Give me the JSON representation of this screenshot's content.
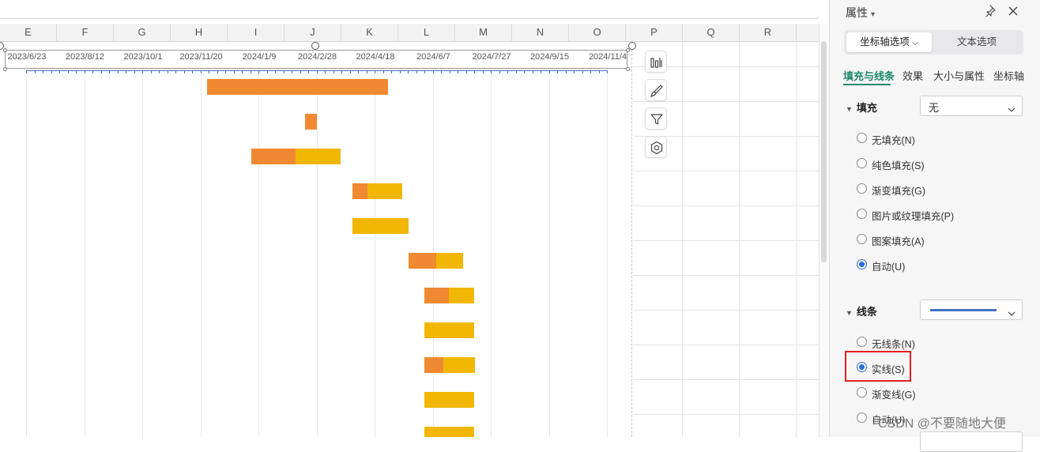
{
  "sheet": {
    "columns": [
      "E",
      "F",
      "G",
      "H",
      "I",
      "J",
      "K",
      "L",
      "M",
      "N",
      "O",
      "P",
      "Q",
      "R"
    ]
  },
  "chart": {
    "axis_tick_labels": [
      "2023/6/23",
      "2023/8/12",
      "2023/10/1",
      "2023/11/20",
      "2024/1/9",
      "2024/2/28",
      "2024/4/18",
      "2024/6/7",
      "2024/7/27",
      "2024/9/15",
      "2024/11/4"
    ],
    "colors": {
      "primary": "#f08a32",
      "secondary": "#f2b705",
      "axis": "#4472c4"
    },
    "side_buttons": [
      "chart-elements-icon",
      "chart-style-icon",
      "chart-filter-icon",
      "chart-settings-icon"
    ]
  },
  "chart_data": {
    "type": "bar",
    "orientation": "horizontal",
    "stacked": true,
    "x_axis_position": "top",
    "x_tick_labels": [
      "2023/6/23",
      "2023/8/12",
      "2023/10/1",
      "2023/11/20",
      "2024/1/9",
      "2024/2/28",
      "2024/4/18",
      "2024/6/7",
      "2024/7/27",
      "2024/9/15",
      "2024/11/4"
    ],
    "xlim": [
      "2023/6/23",
      "2024/11/4"
    ],
    "grid": "vertical",
    "legend": "none",
    "rows": [
      {
        "start": "2023/11/26",
        "segments": [
          {
            "color": "#f08a32",
            "days": 156
          }
        ]
      },
      {
        "start": "2024/2/18",
        "segments": [
          {
            "color": "#f08a32",
            "days": 10
          }
        ]
      },
      {
        "start": "2024/1/3",
        "segments": [
          {
            "color": "#f08a32",
            "days": 38
          },
          {
            "color": "#f2b705",
            "days": 39
          }
        ]
      },
      {
        "start": "2024/3/30",
        "segments": [
          {
            "color": "#f08a32",
            "days": 13
          },
          {
            "color": "#f2b705",
            "days": 30
          }
        ]
      },
      {
        "start": "2024/3/30",
        "segments": [
          {
            "color": "#f2b705",
            "days": 48
          }
        ]
      },
      {
        "start": "2024/5/17",
        "segments": [
          {
            "color": "#f08a32",
            "days": 24
          },
          {
            "color": "#f2b705",
            "days": 23
          }
        ]
      },
      {
        "start": "2024/5/31",
        "segments": [
          {
            "color": "#f08a32",
            "days": 21
          },
          {
            "color": "#f2b705",
            "days": 22
          }
        ]
      },
      {
        "start": "2024/5/31",
        "segments": [
          {
            "color": "#f2b705",
            "days": 43
          }
        ]
      },
      {
        "start": "2024/5/31",
        "segments": [
          {
            "color": "#f08a32",
            "days": 16
          },
          {
            "color": "#f2b705",
            "days": 27
          }
        ]
      },
      {
        "start": "2024/5/31",
        "segments": [
          {
            "color": "#f2b705",
            "days": 43
          }
        ]
      },
      {
        "start": "2024/5/31",
        "segments": [
          {
            "color": "#f2b705",
            "days": 43
          }
        ]
      }
    ]
  },
  "panel": {
    "title": "属性",
    "seg_tabs": {
      "axis_options": "坐标轴选项",
      "text_options": "文本选项"
    },
    "subtabs": [
      "填充与线条",
      "效果",
      "大小与属性",
      "坐标轴"
    ],
    "fill": {
      "label": "填充",
      "dropdown_value": "无",
      "options": [
        "无填充(N)",
        "纯色填充(S)",
        "渐变填充(G)",
        "图片或纹理填充(P)",
        "图案填充(A)",
        "自动(U)"
      ],
      "selected": "自动(U)"
    },
    "line": {
      "label": "线条",
      "line_color": "#4472c4",
      "options": [
        "无线条(N)",
        "实线(S)",
        "渐变线(G)",
        "自动(U)"
      ],
      "selected": "实线(S)"
    }
  },
  "watermark": "CSDN @不要随地大便"
}
